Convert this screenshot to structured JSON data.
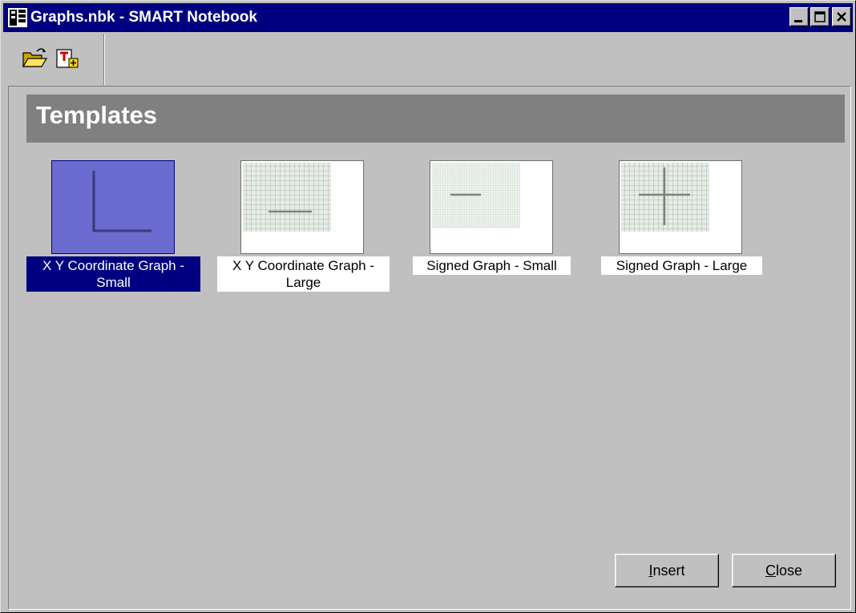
{
  "window": {
    "title": "Graphs.nbk - SMART Notebook",
    "controls": [
      "minimize-icon",
      "maximize-icon",
      "close-icon"
    ]
  },
  "toolbar": {
    "buttons": [
      {
        "icon": "open-folder-icon"
      },
      {
        "icon": "insert-template-icon"
      }
    ]
  },
  "templates": {
    "header": "Templates",
    "items": [
      {
        "line1": "X Y Coordinate Graph -",
        "line2": "Small",
        "selected": true
      },
      {
        "line1": "X Y Coordinate Graph -",
        "line2": "Large",
        "selected": false
      },
      {
        "line1": "Signed Graph - Small",
        "selected": false
      },
      {
        "line1": "Signed Graph - Large",
        "selected": false
      }
    ]
  },
  "actions": {
    "insert": {
      "mnemonic": "I",
      "rest": "nsert"
    },
    "close": {
      "mnemonic": "C",
      "rest": "lose"
    }
  },
  "colors": {
    "titlebar": "#000080",
    "face": "#c0c0c0",
    "header": "#808080",
    "selection": "#000080"
  }
}
